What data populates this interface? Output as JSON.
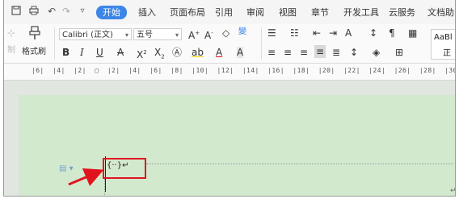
{
  "tabs": [
    "开始",
    "插入",
    "页面布局",
    "引用",
    "审阅",
    "视图",
    "章节",
    "开发工具",
    "云服务",
    "文档助"
  ],
  "quick_access": [
    "save-icon",
    "print-icon",
    "undo-icon",
    "redo-icon",
    "customize-icon"
  ],
  "ribbon": {
    "format_painter": "格式刷",
    "font_name": "Calibri (正文)",
    "font_size": "五号",
    "style_preview": "AaBl",
    "style_sub": "正"
  },
  "ruler_text": "|6|  |4|  |2|  ▢  |2|  |4|  |6|  |8|  |10|  |12|  |14|  |16|  |18|  |20|  |22|  |24|  |26|  |28|  |30|  |32|  |34|",
  "field_code": "{··}↵",
  "return_mark": "↵",
  "accent_color": "#3c86e8",
  "highlight_color": "#e0141e",
  "page_bg": "#d3e9ce"
}
